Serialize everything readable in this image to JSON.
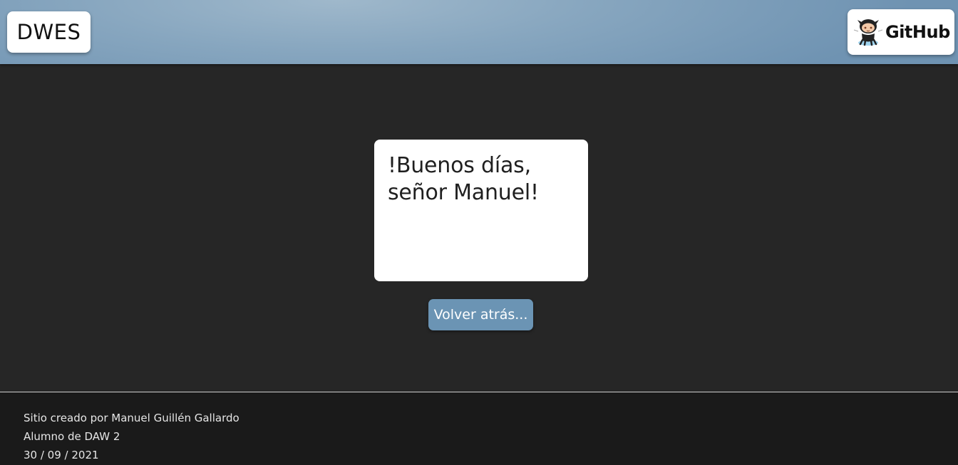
{
  "header": {
    "logo_text": "DWES",
    "github_label": "GitHub",
    "github_icon": "octocat-icon",
    "background_color": "#87a6bf"
  },
  "main": {
    "greeting": "!Buenos días, señor Manuel!",
    "back_button_label": "Volver atrás..."
  },
  "footer": {
    "author": "Sitio creado por Manuel Guillén Gallardo",
    "course": "Alumno de DAW 2",
    "date": "30 / 09 / 2021"
  },
  "colors": {
    "page_background": "#262626",
    "footer_background": "#1a1a1a",
    "button_background": "#6b94b4"
  }
}
